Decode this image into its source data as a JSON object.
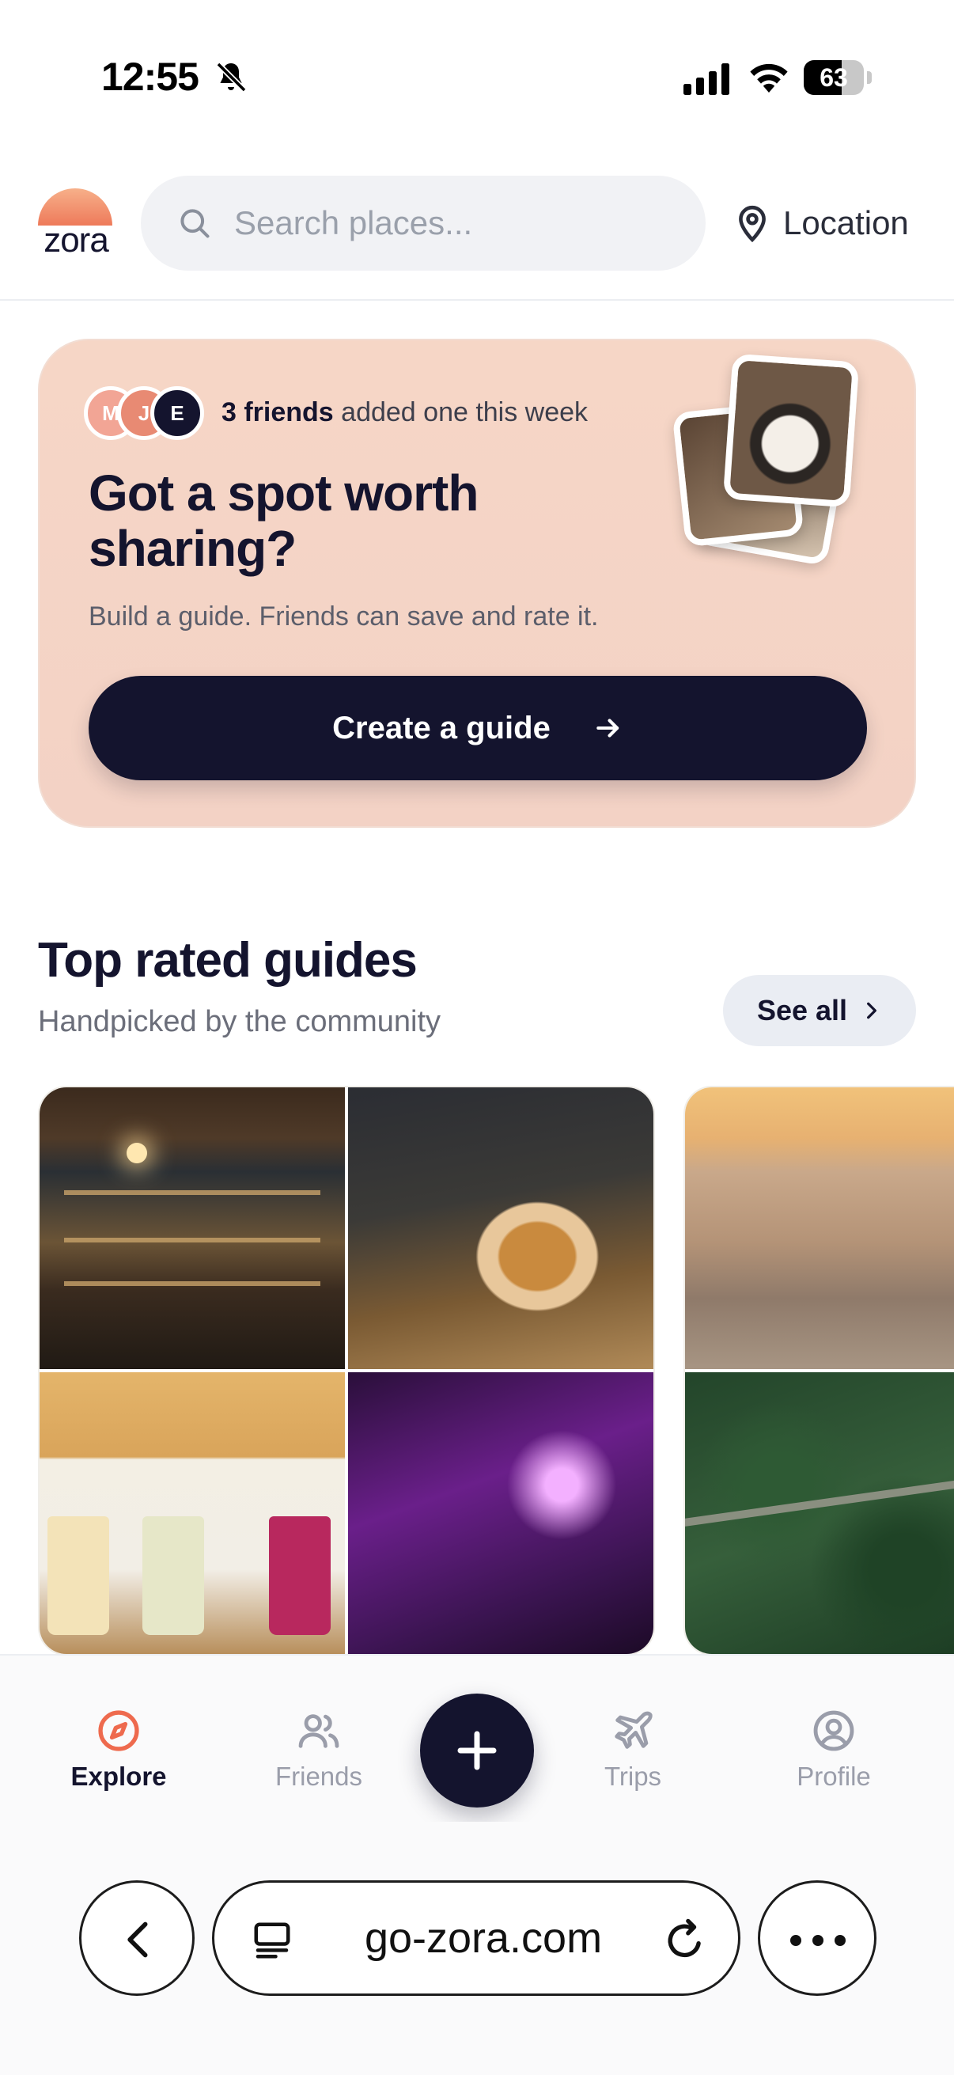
{
  "status_bar": {
    "time": "12:55",
    "battery_level": "63",
    "battery_percent": 63,
    "silent_mode": true
  },
  "header": {
    "logo_text": "zora",
    "search": {
      "placeholder": "Search places...",
      "value": ""
    },
    "location_label": "Location"
  },
  "promo": {
    "avatars": [
      "M",
      "J",
      "E"
    ],
    "friends_count": "3 friends",
    "friends_suffix": " added one this week",
    "title": "Got a spot worth sharing?",
    "subtitle": "Build a guide. Friends can save and rate it.",
    "cta_label": "Create a guide"
  },
  "top_rated": {
    "title": "Top rated guides",
    "subtitle": "Handpicked by the community",
    "see_all_label": "See all"
  },
  "bottom_nav": {
    "items": [
      {
        "label": "Explore",
        "icon": "compass-icon",
        "active": true
      },
      {
        "label": "Friends",
        "icon": "users-icon",
        "active": false
      },
      {
        "label": "Trips",
        "icon": "plane-icon",
        "active": false
      },
      {
        "label": "Profile",
        "icon": "user-circle-icon",
        "active": false
      }
    ],
    "fab_icon": "plus-icon"
  },
  "browser": {
    "url": "go-zora.com"
  },
  "colors": {
    "brand_navy": "#14142e",
    "accent_coral": "#ee6a4e",
    "promo_bg": "#f6d6c6"
  }
}
